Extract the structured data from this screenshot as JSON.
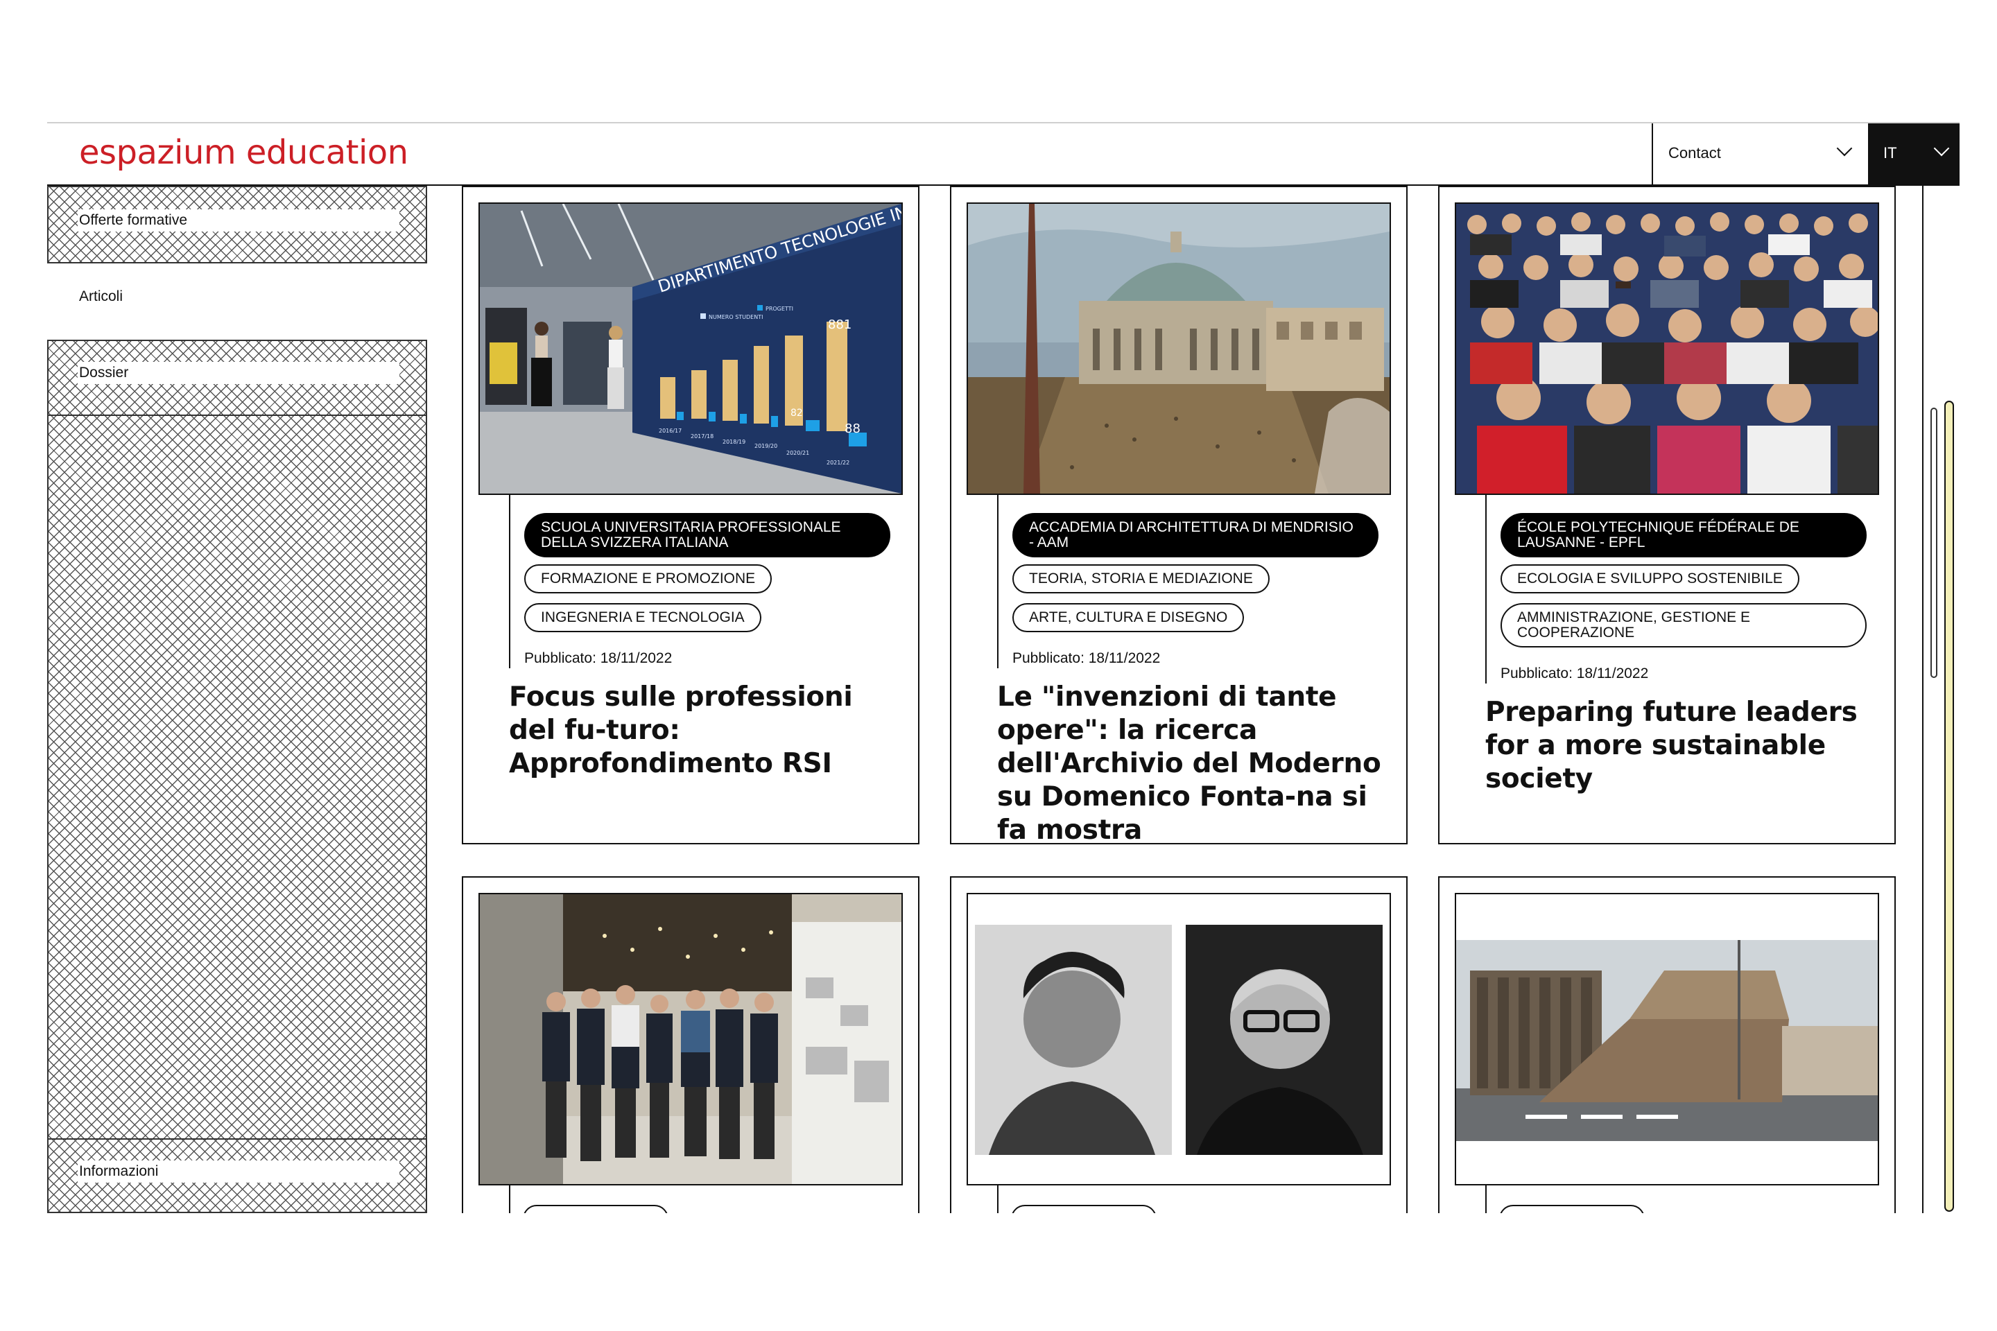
{
  "header": {
    "logo": "espazium education",
    "contact_label": "Contact",
    "language": "IT"
  },
  "sidebar": {
    "items": [
      {
        "label": "Offerte formative"
      },
      {
        "label": "Articoli"
      },
      {
        "label": "Dossier"
      },
      {
        "label": "Informazioni"
      }
    ]
  },
  "cards": [
    {
      "institution": "SCUOLA UNIVERSITARIA PROFESSIONALE DELLA SVIZZERA ITALIANA",
      "tags": [
        "FORMAZIONE E PROMOZIONE",
        "INGEGNERIA E TECNOLOGIA"
      ],
      "published": "Pubblicato: 18/11/2022",
      "title": "Focus sulle professioni del fu-turo: Approfondimento RSI",
      "image": {
        "screen_heading": "DIPARTIMENTO TECNOLOGIE INNOVATIVE SUPSI",
        "legend": [
          "NUMERO STUDENTI",
          "PROGETTI"
        ],
        "bar_labels": [
          "881",
          "82",
          "88"
        ],
        "years": [
          "2016/17",
          "2017/18",
          "2018/19",
          "2019/20",
          "2020/21",
          "2021/22"
        ]
      }
    },
    {
      "institution": "ACCADEMIA DI ARCHITETTURA DI MENDRISIO - AAM",
      "tags": [
        "TEORIA, STORIA E MEDIAZIONE",
        "ARTE, CULTURA E DISEGNO"
      ],
      "published": "Pubblicato: 18/11/2022",
      "title": "Le \"invenzioni di tante opere\": la ricerca dell'Archivio del Moderno su Domenico Fonta-na si fa mostra"
    },
    {
      "institution": "ÉCOLE POLYTECHNIQUE FÉDÉRALE DE LAUSANNE - EPFL",
      "tags": [
        "ECOLOGIA E SVILUPPO SOSTENIBILE",
        "AMMINISTRAZIONE, GESTIONE E COOPERAZIONE"
      ],
      "published": "Pubblicato: 18/11/2022",
      "title": "Preparing future leaders for a more sustainable society"
    }
  ],
  "colors": {
    "brand": "#cc1f26",
    "ink": "#111111",
    "scroll_track": "#f3efb8"
  }
}
